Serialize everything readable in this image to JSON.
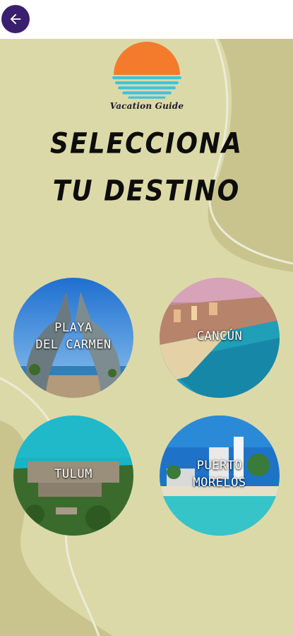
{
  "header": {
    "back_icon": "arrow-left-icon"
  },
  "brand": {
    "name": "Vacation Guide",
    "logo_icon": "sunset-over-water-icon"
  },
  "headline": {
    "line1": "SELECCIONA",
    "line2": "TU DESTINO"
  },
  "destinations": [
    {
      "line1": "PLAYA",
      "line2": "DEL CARMEN"
    },
    {
      "line1": "CANCÚN",
      "line2": ""
    },
    {
      "line1": "TULUM",
      "line2": ""
    },
    {
      "line1": "PUERTO",
      "line2": "MORELOS"
    }
  ],
  "colors": {
    "background": "#dcd9a9",
    "accent": "#3a1f6e",
    "sun": "#f47a2c",
    "water": "#3cc4dc"
  }
}
